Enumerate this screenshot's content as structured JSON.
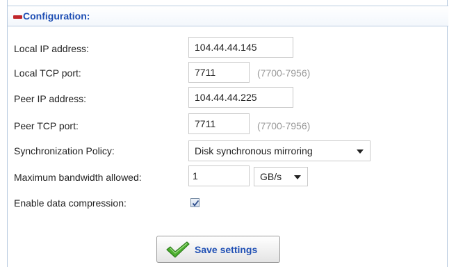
{
  "section": {
    "title": "Configuration:"
  },
  "fields": {
    "local_ip": {
      "label": "Local IP address:",
      "value": "104.44.44.145"
    },
    "local_port": {
      "label": "Local TCP port:",
      "value": "7711",
      "hint": "(7700-7956)"
    },
    "peer_ip": {
      "label": "Peer IP address:",
      "value": "104.44.44.225"
    },
    "peer_port": {
      "label": "Peer TCP port:",
      "value": "7711",
      "hint": "(7700-7956)"
    },
    "sync_policy": {
      "label": "Synchronization Policy:",
      "selected": "Disk synchronous mirroring"
    },
    "bandwidth": {
      "label": "Maximum bandwidth allowed:",
      "value": "1",
      "unit": "GB/s"
    },
    "compression": {
      "label": "Enable data compression:",
      "checked": true
    }
  },
  "actions": {
    "save_label": "Save settings"
  },
  "colors": {
    "accent": "#1f4fb4",
    "collapse": "#c0262b",
    "checkmark": "#3aa12b",
    "border": "#b9cbe0"
  }
}
